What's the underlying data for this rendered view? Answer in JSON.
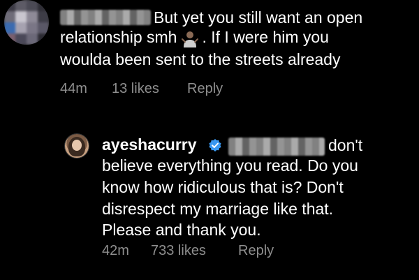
{
  "comments": [
    {
      "line1": "But yet you still want an open",
      "line2_text": "relationship smh",
      "line2_after": ". If I were him you",
      "line3": "woulda been sent to the streets already",
      "emoji": "person-shrugging-emoji",
      "time": "44m",
      "likes": "13 likes",
      "reply": "Reply"
    },
    {
      "username": "ayeshacurry",
      "verified_icon": "verified-badge-icon",
      "line1": "don't",
      "line2": "believe everything you read. Do you",
      "line3": "know how ridiculous that is? Don't",
      "line4": "disrespect my marriage like that.",
      "line5": "Please and thank you.",
      "time": "42m",
      "likes": "733 likes",
      "reply": "Reply"
    }
  ],
  "colors": {
    "background": "#000000",
    "text": "#ffffff",
    "meta": "#8e8e8e",
    "verified": "#3897f0"
  }
}
